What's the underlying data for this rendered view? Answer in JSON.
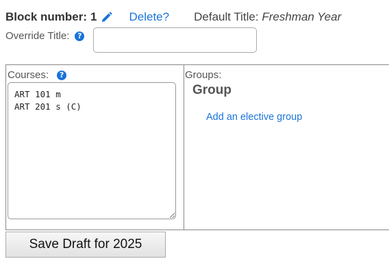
{
  "header": {
    "block_label": "Block number:",
    "block_number": "1",
    "delete_label": "Delete?",
    "default_title_label": "Default Title:",
    "default_title_value": "Freshman Year"
  },
  "override": {
    "label": "Override Title:",
    "value": "",
    "help_icon": "question-circle-icon"
  },
  "courses": {
    "label": "Courses:",
    "help_icon": "question-circle-icon",
    "text": "ART 101 m\nART 201 s (C)"
  },
  "groups": {
    "label": "Groups:",
    "heading": "Group",
    "add_link": "Add an elective group"
  },
  "save_button_label": "Save Draft for 2025",
  "colors": {
    "link": "#1a73d9",
    "text": "#333333"
  }
}
